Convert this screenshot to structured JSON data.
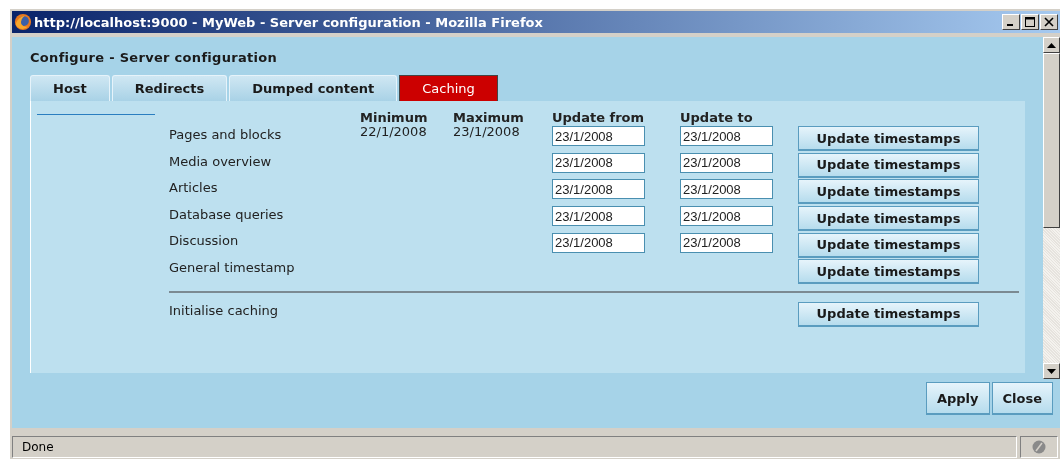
{
  "window": {
    "title": "http://localhost:9000 - MyWeb - Server configuration - Mozilla Firefox"
  },
  "dialog": {
    "title": "Configure - Server configuration"
  },
  "tabs": [
    {
      "label": "Host",
      "selected": false
    },
    {
      "label": "Redirects",
      "selected": false
    },
    {
      "label": "Dumped content",
      "selected": false
    },
    {
      "label": "Caching",
      "selected": true
    }
  ],
  "caching": {
    "columns": [
      "Minimum",
      "Maximum",
      "Update from",
      "Update to"
    ],
    "rows": [
      {
        "label": "Pages and blocks",
        "minimum": "22/1/2008",
        "maximum": "23/1/2008",
        "update_from": "23/1/2008",
        "update_to": "23/1/2008",
        "button": "Update timestamps"
      },
      {
        "label": "Media overview",
        "update_from": "23/1/2008",
        "update_to": "23/1/2008",
        "button": "Update timestamps"
      },
      {
        "label": "Articles",
        "update_from": "23/1/2008",
        "update_to": "23/1/2008",
        "button": "Update timestamps"
      },
      {
        "label": "Database queries",
        "update_from": "23/1/2008",
        "update_to": "23/1/2008",
        "button": "Update timestamps"
      },
      {
        "label": "Discussion",
        "update_from": "23/1/2008",
        "update_to": "23/1/2008",
        "button": "Update timestamps"
      },
      {
        "label": "General timestamp",
        "button": "Update timestamps"
      }
    ],
    "initialise": {
      "label": "Initialise caching",
      "button": "Update timestamps"
    }
  },
  "buttons": [
    "Apply",
    "Close"
  ],
  "status_bar": {
    "text": "Done"
  }
}
